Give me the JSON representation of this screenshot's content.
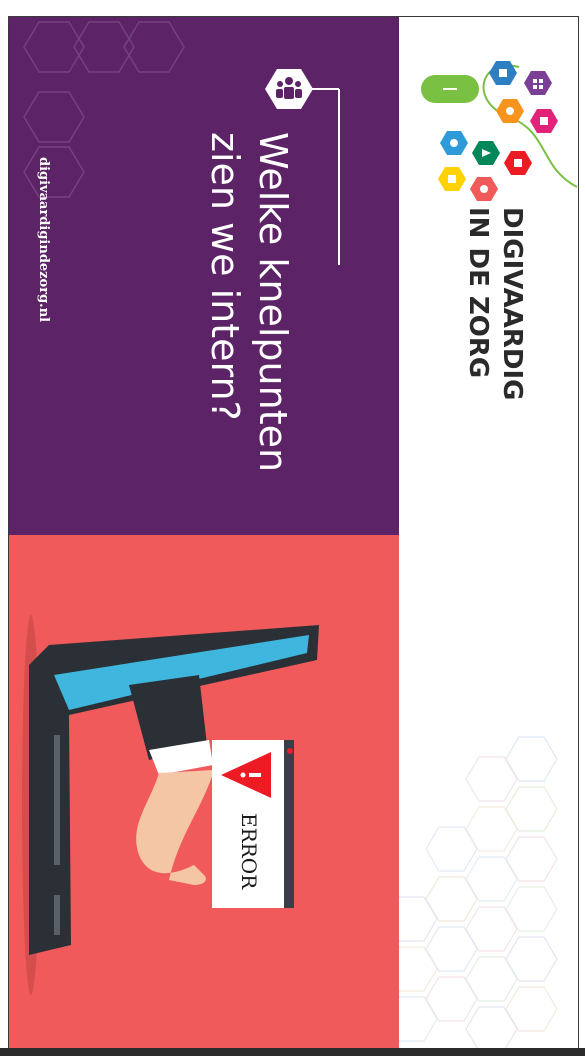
{
  "brand": {
    "line1": "DIGIVAARDIG",
    "line2": "IN DE ZORG",
    "icons": [
      "lock-icon",
      "grid-icon",
      "hand-icon",
      "thumb-icon",
      "heart-icon",
      "arrow-icon",
      "phone-icon",
      "tablet-icon",
      "users-icon",
      "mouse-icon"
    ],
    "colors": {
      "green": "#7ac143",
      "blue": "#2e7fc1",
      "purple": "#7b3f98",
      "pink": "#e2237a",
      "orange": "#f7941d",
      "yellow": "#ffd200",
      "red": "#ed1c24",
      "teal": "#00a99d"
    }
  },
  "slide": {
    "heading_line1": "Welke knelpunten",
    "heading_line2": "zien we intern?",
    "website": "digivaardigindezorg.nl",
    "error_label": "ERROR",
    "colors": {
      "purple": "#5c2366",
      "coral": "#f15a5a"
    }
  }
}
